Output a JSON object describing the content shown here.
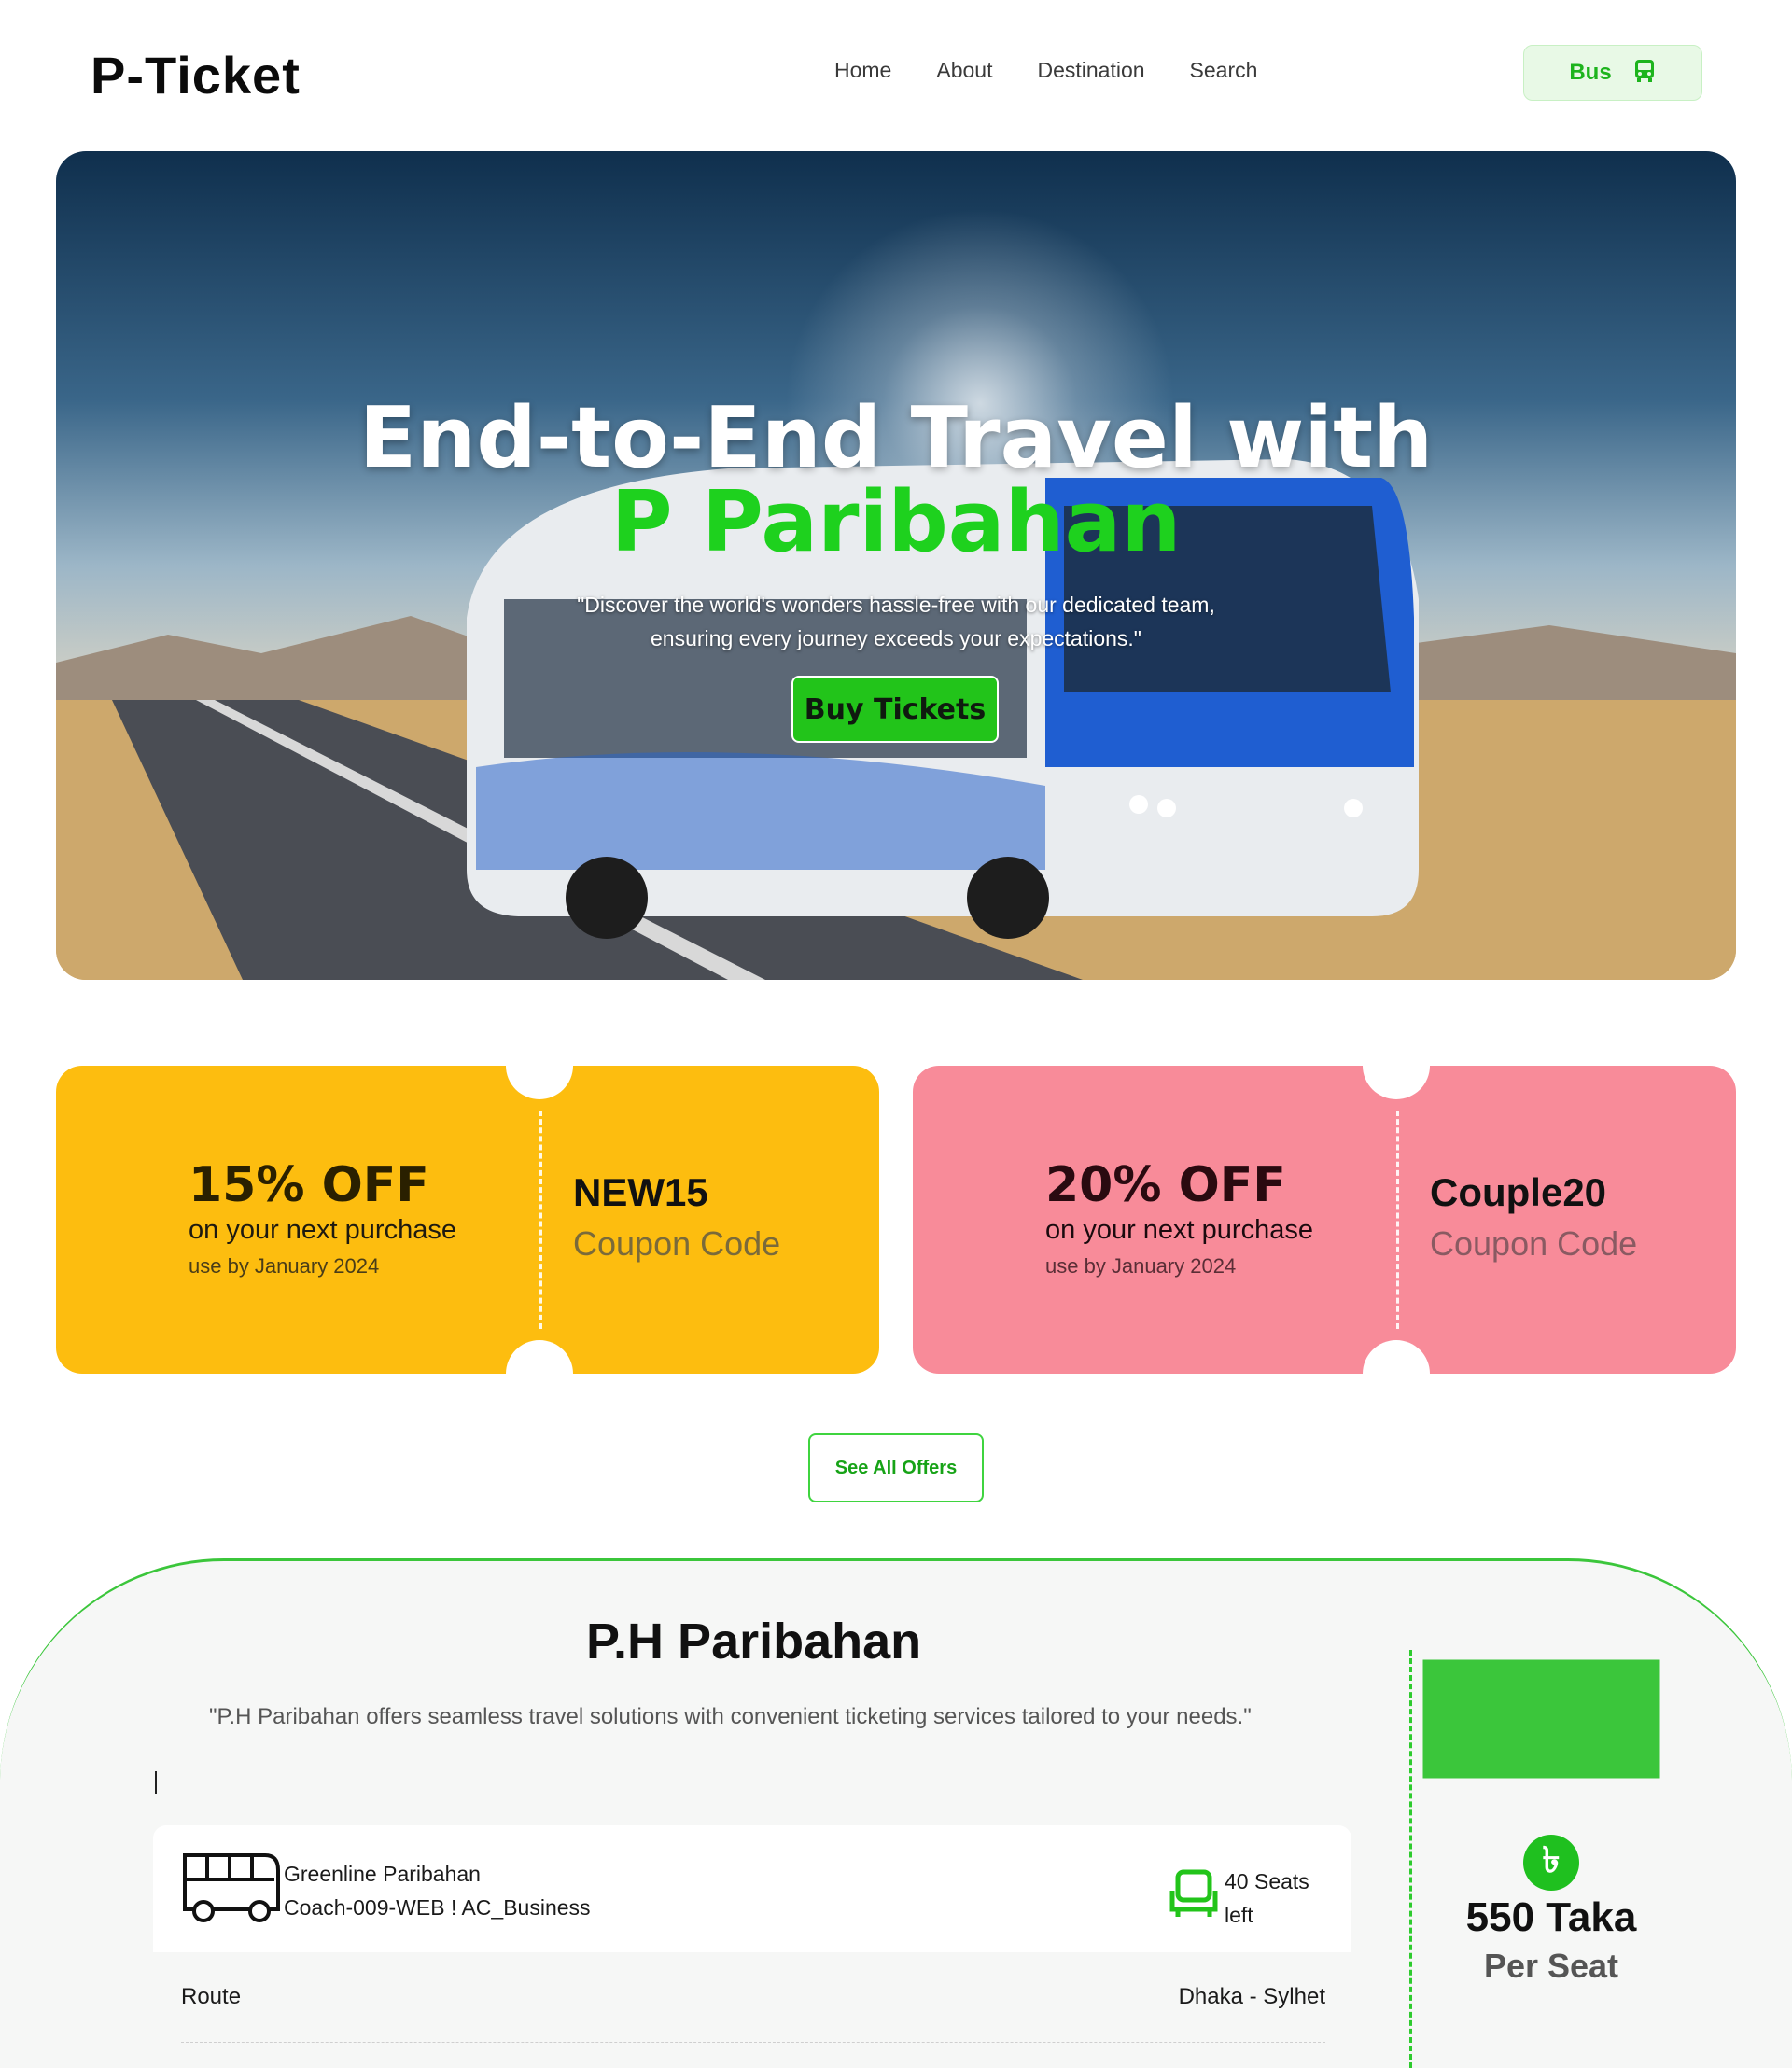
{
  "header": {
    "logo": "P-Ticket",
    "nav": [
      "Home",
      "About",
      "Destination",
      "Search"
    ],
    "bus_button": "Bus"
  },
  "hero": {
    "title_line1": "End-to-End Travel with",
    "title_line2": "P Paribahan",
    "subtitle_line1": "\"Discover the world's wonders hassle-free with our dedicated team,",
    "subtitle_line2": "ensuring every journey exceeds your expectations.\"",
    "cta": "Buy Tickets"
  },
  "coupons": [
    {
      "discount": "15% OFF",
      "text": "on your next purchase",
      "validity": "use by January 2024",
      "code": "NEW15",
      "label": "Coupon Code",
      "color": "#fdbd0f"
    },
    {
      "discount": "20% OFF",
      "text": "on your next purchase",
      "validity": "use by January 2024",
      "code": "Couple20",
      "label": "Coupon Code",
      "color": "#f88b99"
    }
  ],
  "offers_button": "See All Offers",
  "section": {
    "title": "P.H Paribahan",
    "subtitle": "\"P.H Paribahan offers seamless travel solutions with convenient ticketing services tailored to your needs.\"",
    "bus_name": "Greenline Paribahan",
    "coach": "Coach-009-WEB ! AC_Business",
    "seats_line1": "40 Seats",
    "seats_line2": "left",
    "route_label": "Route",
    "route_value": "Dhaka - Sylhet",
    "price": "550 Taka",
    "per": "Per Seat",
    "currency_symbol": "৳"
  },
  "colors": {
    "accent": "#22c41a",
    "coupon_yellow": "#fdbd0f",
    "coupon_pink": "#f88b99"
  }
}
